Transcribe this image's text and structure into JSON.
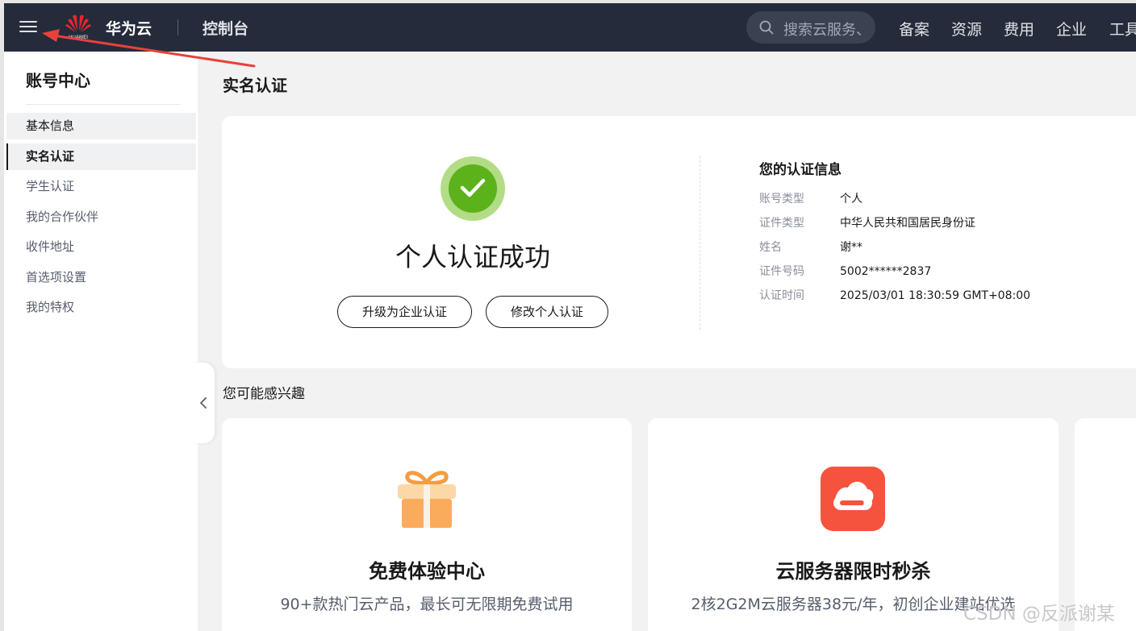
{
  "topbar": {
    "brand": "华为云",
    "logo_text": "HUAWEI",
    "console": "控制台",
    "search_placeholder": "搜索云服务、",
    "nav": [
      "备案",
      "资源",
      "费用",
      "企业",
      "工具"
    ]
  },
  "sidebar": {
    "title": "账号中心",
    "items": [
      {
        "label": "基本信息"
      },
      {
        "label": "实名认证"
      },
      {
        "label": "学生认证"
      },
      {
        "label": "我的合作伙伴"
      },
      {
        "label": "收件地址"
      },
      {
        "label": "首选项设置"
      },
      {
        "label": "我的特权"
      }
    ],
    "active_index": 1
  },
  "main": {
    "page_title": "实名认证",
    "status": {
      "text": "个人认证成功",
      "upgrade_button": "升级为企业认证",
      "modify_button": "修改个人认证"
    },
    "info": {
      "heading": "您的认证信息",
      "rows": [
        {
          "label": "账号类型",
          "value": "个人"
        },
        {
          "label": "证件类型",
          "value": "中华人民共和国居民身份证"
        },
        {
          "label": "姓名",
          "value": "谢**"
        },
        {
          "label": "证件号码",
          "value": "5002******2837"
        },
        {
          "label": "认证时间",
          "value": "2025/03/01 18:30:59 GMT+08:00"
        }
      ]
    },
    "interest": {
      "title": "您可能感兴趣",
      "cards": [
        {
          "title": "免费体验中心",
          "subtitle": "90+款热门云产品，最长可无限期免费试用",
          "icon": "gift-icon"
        },
        {
          "title": "云服务器限时秒杀",
          "subtitle": "2核2G2M云服务器38元/年，初创企业建站优选",
          "icon": "cloud-server-icon"
        }
      ]
    }
  },
  "watermark": "CSDN @反派谢某",
  "colors": {
    "topbar": "#252b3a",
    "success_green": "#5cb21b",
    "success_ring": "#b3dc86",
    "gift_orange": "#fbab5c",
    "server_red": "#f5533d",
    "annotation_arrow": "#e8413b"
  }
}
